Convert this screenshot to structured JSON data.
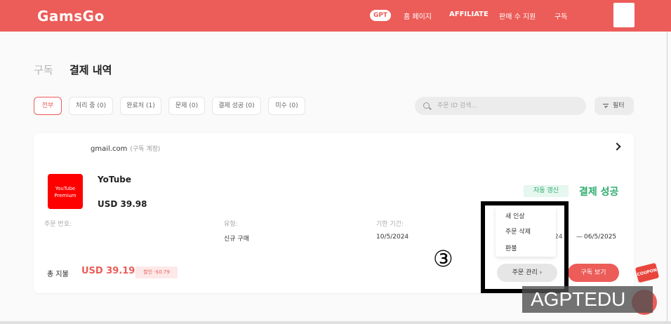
{
  "header": {
    "logo": "GamsGo",
    "nav": {
      "gpt": "GPT",
      "home": "홈 페이지",
      "affiliate": "AFFILIATE",
      "seller": "판매 수 지원",
      "subscription": "구독"
    }
  },
  "breadcrumb": {
    "parent": "구독",
    "current": "결제 내역"
  },
  "filters": {
    "tabs": [
      "전부",
      "처리 중 (0)",
      "완료처 (1)",
      "문제 (0)",
      "결제 성공 (0)",
      "미수 (0)"
    ],
    "active_index": 0,
    "search_placeholder": "주문 ID 검색...",
    "filter_label": "필터"
  },
  "order": {
    "email": "gmail.com",
    "email_note": "(구독 계정)",
    "product": {
      "logo_text": "YouTube Premium",
      "name": "YoTube",
      "price": "USD 39.98"
    },
    "auto_renew": "자동 갱신",
    "status": "결제 성공",
    "status_color": "#2eab6e",
    "labels": {
      "order_no": "주문 번호:",
      "type": "유형:",
      "period": "기한 기간:"
    },
    "values": {
      "type": "신규 구매",
      "start": "10/5/2024",
      "dash": "—",
      "end": "06/5/2025",
      "ghost": "24"
    },
    "total_label": "총 지불",
    "total": "USD 39.19",
    "discount": "할인 -$0.79",
    "view_button": "구독 보기"
  },
  "manage_menu": {
    "items": [
      "새 인상",
      "주문 삭제",
      "환불"
    ],
    "button": "주문 관리 ›"
  },
  "annotation": {
    "step": "③"
  },
  "coupon": "COUPON",
  "watermark": "AGPTEDU",
  "colors": {
    "brand": "#ec5c58",
    "success": "#2eab6e"
  }
}
